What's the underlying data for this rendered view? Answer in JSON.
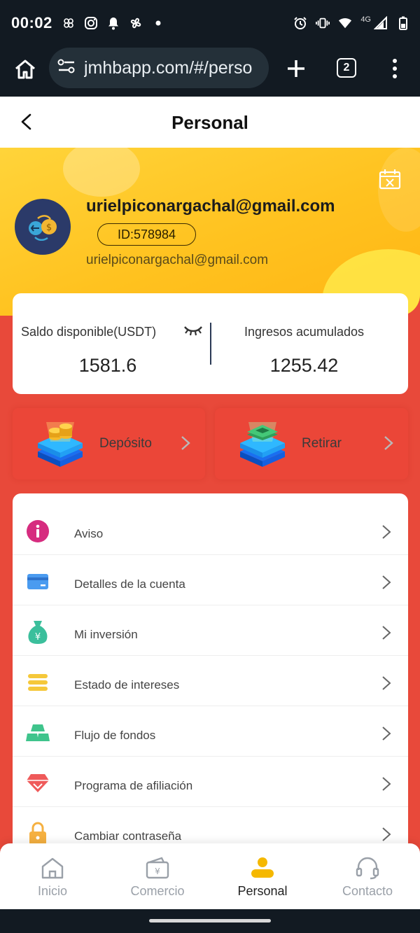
{
  "status_bar": {
    "time": "00:02",
    "network": "4G"
  },
  "browser": {
    "url": "jmhbapp.com/#/perso",
    "tab_count": "2"
  },
  "header": {
    "title": "Personal"
  },
  "profile": {
    "name": "urielpiconargachal@gmail.com",
    "id_label": "ID:578984",
    "email": "urielpiconargachal@gmail.com"
  },
  "balance": {
    "available_label": "Saldo disponible(USDT)",
    "available_value": "1581.6",
    "accumulated_label": "Ingresos acumulados",
    "accumulated_value": "1255.42"
  },
  "actions": {
    "deposit_label": "Depósito",
    "withdraw_label": "Retirar"
  },
  "menu": [
    {
      "label": "Aviso",
      "icon": "info-icon"
    },
    {
      "label": "Detalles de la cuenta",
      "icon": "card-icon"
    },
    {
      "label": "Mi inversión",
      "icon": "money-bag-icon"
    },
    {
      "label": "Estado de intereses",
      "icon": "stack-icon"
    },
    {
      "label": "Flujo de fondos",
      "icon": "gold-bars-icon"
    },
    {
      "label": "Programa de afiliación",
      "icon": "diamond-icon"
    },
    {
      "label": "Cambiar contraseña",
      "icon": "lock-icon"
    }
  ],
  "nav": [
    {
      "label": "Inicio",
      "icon": "home-icon"
    },
    {
      "label": "Comercio",
      "icon": "wallet-icon"
    },
    {
      "label": "Personal",
      "icon": "person-icon",
      "active": true
    },
    {
      "label": "Contacto",
      "icon": "headset-icon"
    }
  ],
  "colors": {
    "brand_red": "#e8493a",
    "hero_yellow": "#ffc21f",
    "active_nav": "#f5b800"
  }
}
